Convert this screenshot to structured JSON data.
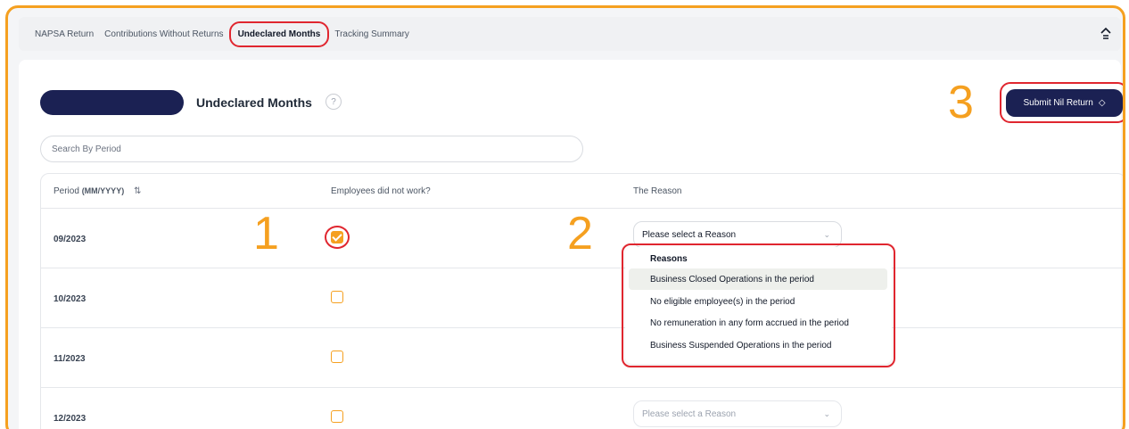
{
  "tabs": [
    {
      "label": "NAPSA Return"
    },
    {
      "label": "Contributions Without Returns"
    },
    {
      "label": "Undeclared Months"
    },
    {
      "label": "Tracking Summary"
    }
  ],
  "page": {
    "title": "Undeclared Months",
    "help": "?"
  },
  "submit": {
    "label": "Submit Nil Return",
    "icon": "◇"
  },
  "search": {
    "placeholder": "Search By Period"
  },
  "table": {
    "headers": {
      "period": "Period",
      "period_format": "(MM/YYYY)",
      "employees": "Employees did not work?",
      "reason": "The Reason"
    },
    "rows": [
      {
        "period": "09/2023",
        "checked": true,
        "reason": "Please select a Reason"
      },
      {
        "period": "10/2023",
        "checked": false
      },
      {
        "period": "11/2023",
        "checked": false
      },
      {
        "period": "12/2023",
        "checked": false,
        "reason": "Please select a Reason"
      }
    ]
  },
  "dropdown": {
    "header": "Reasons",
    "options": [
      "Business Closed Operations in the period",
      "No eligible employee(s) in the period",
      "No remuneration in any form accrued in the period",
      "Business Suspended Operations in the period"
    ]
  },
  "steps": {
    "one": "1",
    "two": "2",
    "three": "3"
  },
  "colors": {
    "accent": "#f5a020",
    "highlight": "#e0262f",
    "brand": "#1b2153"
  }
}
